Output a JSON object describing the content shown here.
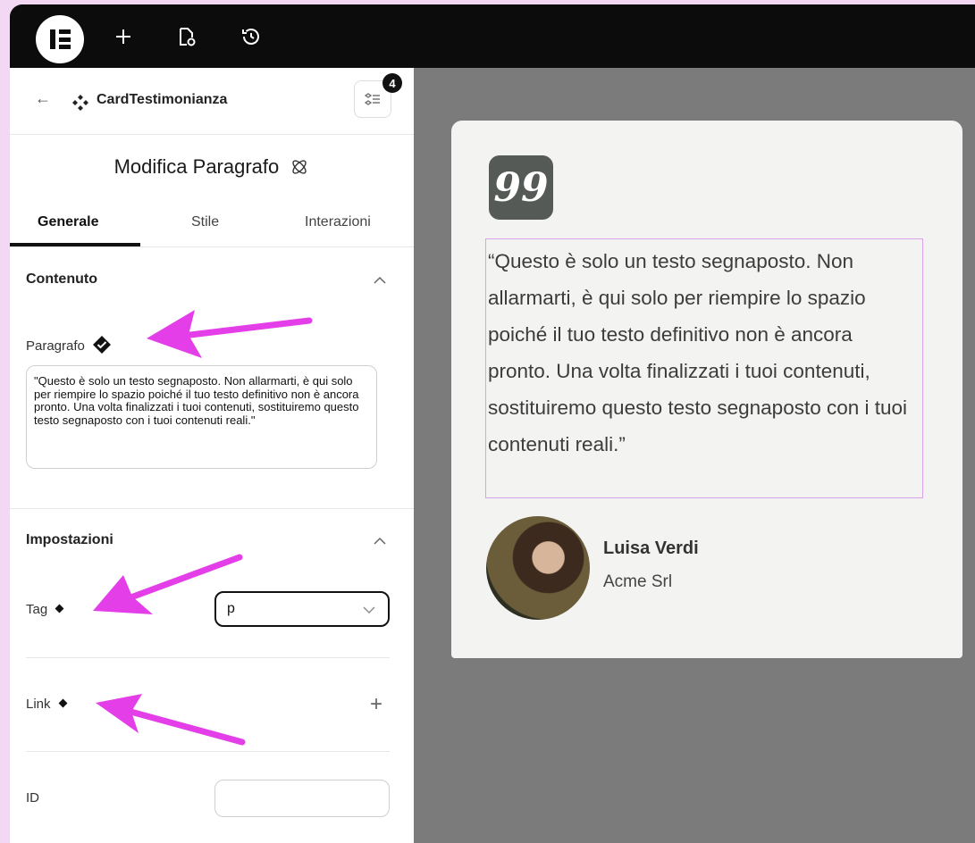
{
  "topbar": {
    "icons": [
      "elementor-logo",
      "plus-icon",
      "page-settings-icon",
      "history-icon"
    ]
  },
  "panel": {
    "back_icon": "←",
    "component_name": "CardTestimonianza",
    "structure_badge": "4",
    "title": "Modifica Paragrafo",
    "tabs": [
      "Generale",
      "Stile",
      "Interazioni"
    ],
    "active_tab": "Generale",
    "content_section": {
      "title": "Contenuto",
      "paragraph_label": "Paragrafo",
      "paragraph_value": "\"Questo è solo un testo segnaposto. Non allarmarti, è qui solo per riempire lo spazio poiché il tuo testo definitivo non è ancora pronto. Una volta finalizzati i tuoi contenuti, sostituiremo questo testo segnaposto con i tuoi contenuti reali.\""
    },
    "settings_section": {
      "title": "Impostazioni",
      "tag_label": "Tag",
      "tag_value": "p",
      "link_label": "Link",
      "link_add": "+",
      "id_label": "ID",
      "id_value": ""
    },
    "annotation_color": "#e33ee8"
  },
  "card": {
    "quote_glyph": "99",
    "quote_text": "“Questo è solo un testo segnaposto. Non allarmarti, è qui solo per riempire lo spazio poiché il tuo testo definitivo non è ancora pronto. Una volta finalizzati i tuoi contenuti, sostituiremo questo testo segnaposto con i tuoi contenuti reali.”",
    "author_name": "Luisa Verdi",
    "author_company": "Acme Srl"
  }
}
